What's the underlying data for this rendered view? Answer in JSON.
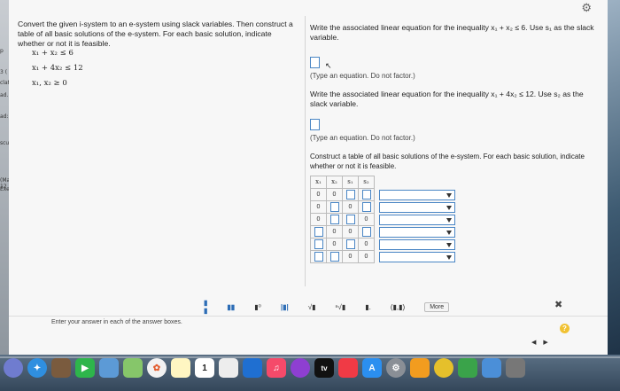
{
  "background": {
    "left_fragments": [
      "p",
      "3 (",
      "clat",
      "ad. (",
      "ad: -",
      "scuss",
      "(May 12",
      "Executiv"
    ]
  },
  "problem": {
    "prompt": "Convert the given i-system to an e-system using slack variables. Then construct a table of all basic solutions of the e-system. For each basic solution, indicate whether or not it is feasible.",
    "system": [
      "x₁ +  x₂ ≤ 6",
      "x₁ + 4x₂ ≤ 12",
      "x₁, x₂ ≥ 0"
    ]
  },
  "questions": [
    {
      "text": "Write the associated linear equation for the inequality x₁ + x₂ ≤ 6. Use s₁ as the slack variable.",
      "hint": "(Type an equation. Do not factor.)"
    },
    {
      "text": "Write the associated linear equation for the inequality x₁ + 4x₂ ≤ 12. Use s₂ as the slack variable.",
      "hint": "(Type an equation. Do not factor.)"
    }
  ],
  "table": {
    "intro": "Construct a table of all basic solutions of the e-system. For each basic solution, indicate whether or not it is feasible.",
    "headers": [
      "x₁",
      "x₂",
      "s₁",
      "s₂"
    ],
    "rows": [
      [
        "0",
        "0",
        "",
        ""
      ],
      [
        "0",
        "",
        "0",
        ""
      ],
      [
        "0",
        "",
        "",
        "0"
      ],
      [
        "",
        "0",
        "0",
        ""
      ],
      [
        "",
        "0",
        "",
        "0"
      ],
      [
        "",
        "",
        "0",
        "0"
      ]
    ]
  },
  "toolbar": {
    "more_label": "More",
    "close_glyph": "✖"
  },
  "footer": {
    "instruction": "Enter your answer in each of the answer boxes.",
    "help_glyph": "?",
    "prev_glyph": "◀",
    "next_glyph": "▶"
  },
  "dock": {
    "tv_label": "tv",
    "calendar_day": "1"
  }
}
